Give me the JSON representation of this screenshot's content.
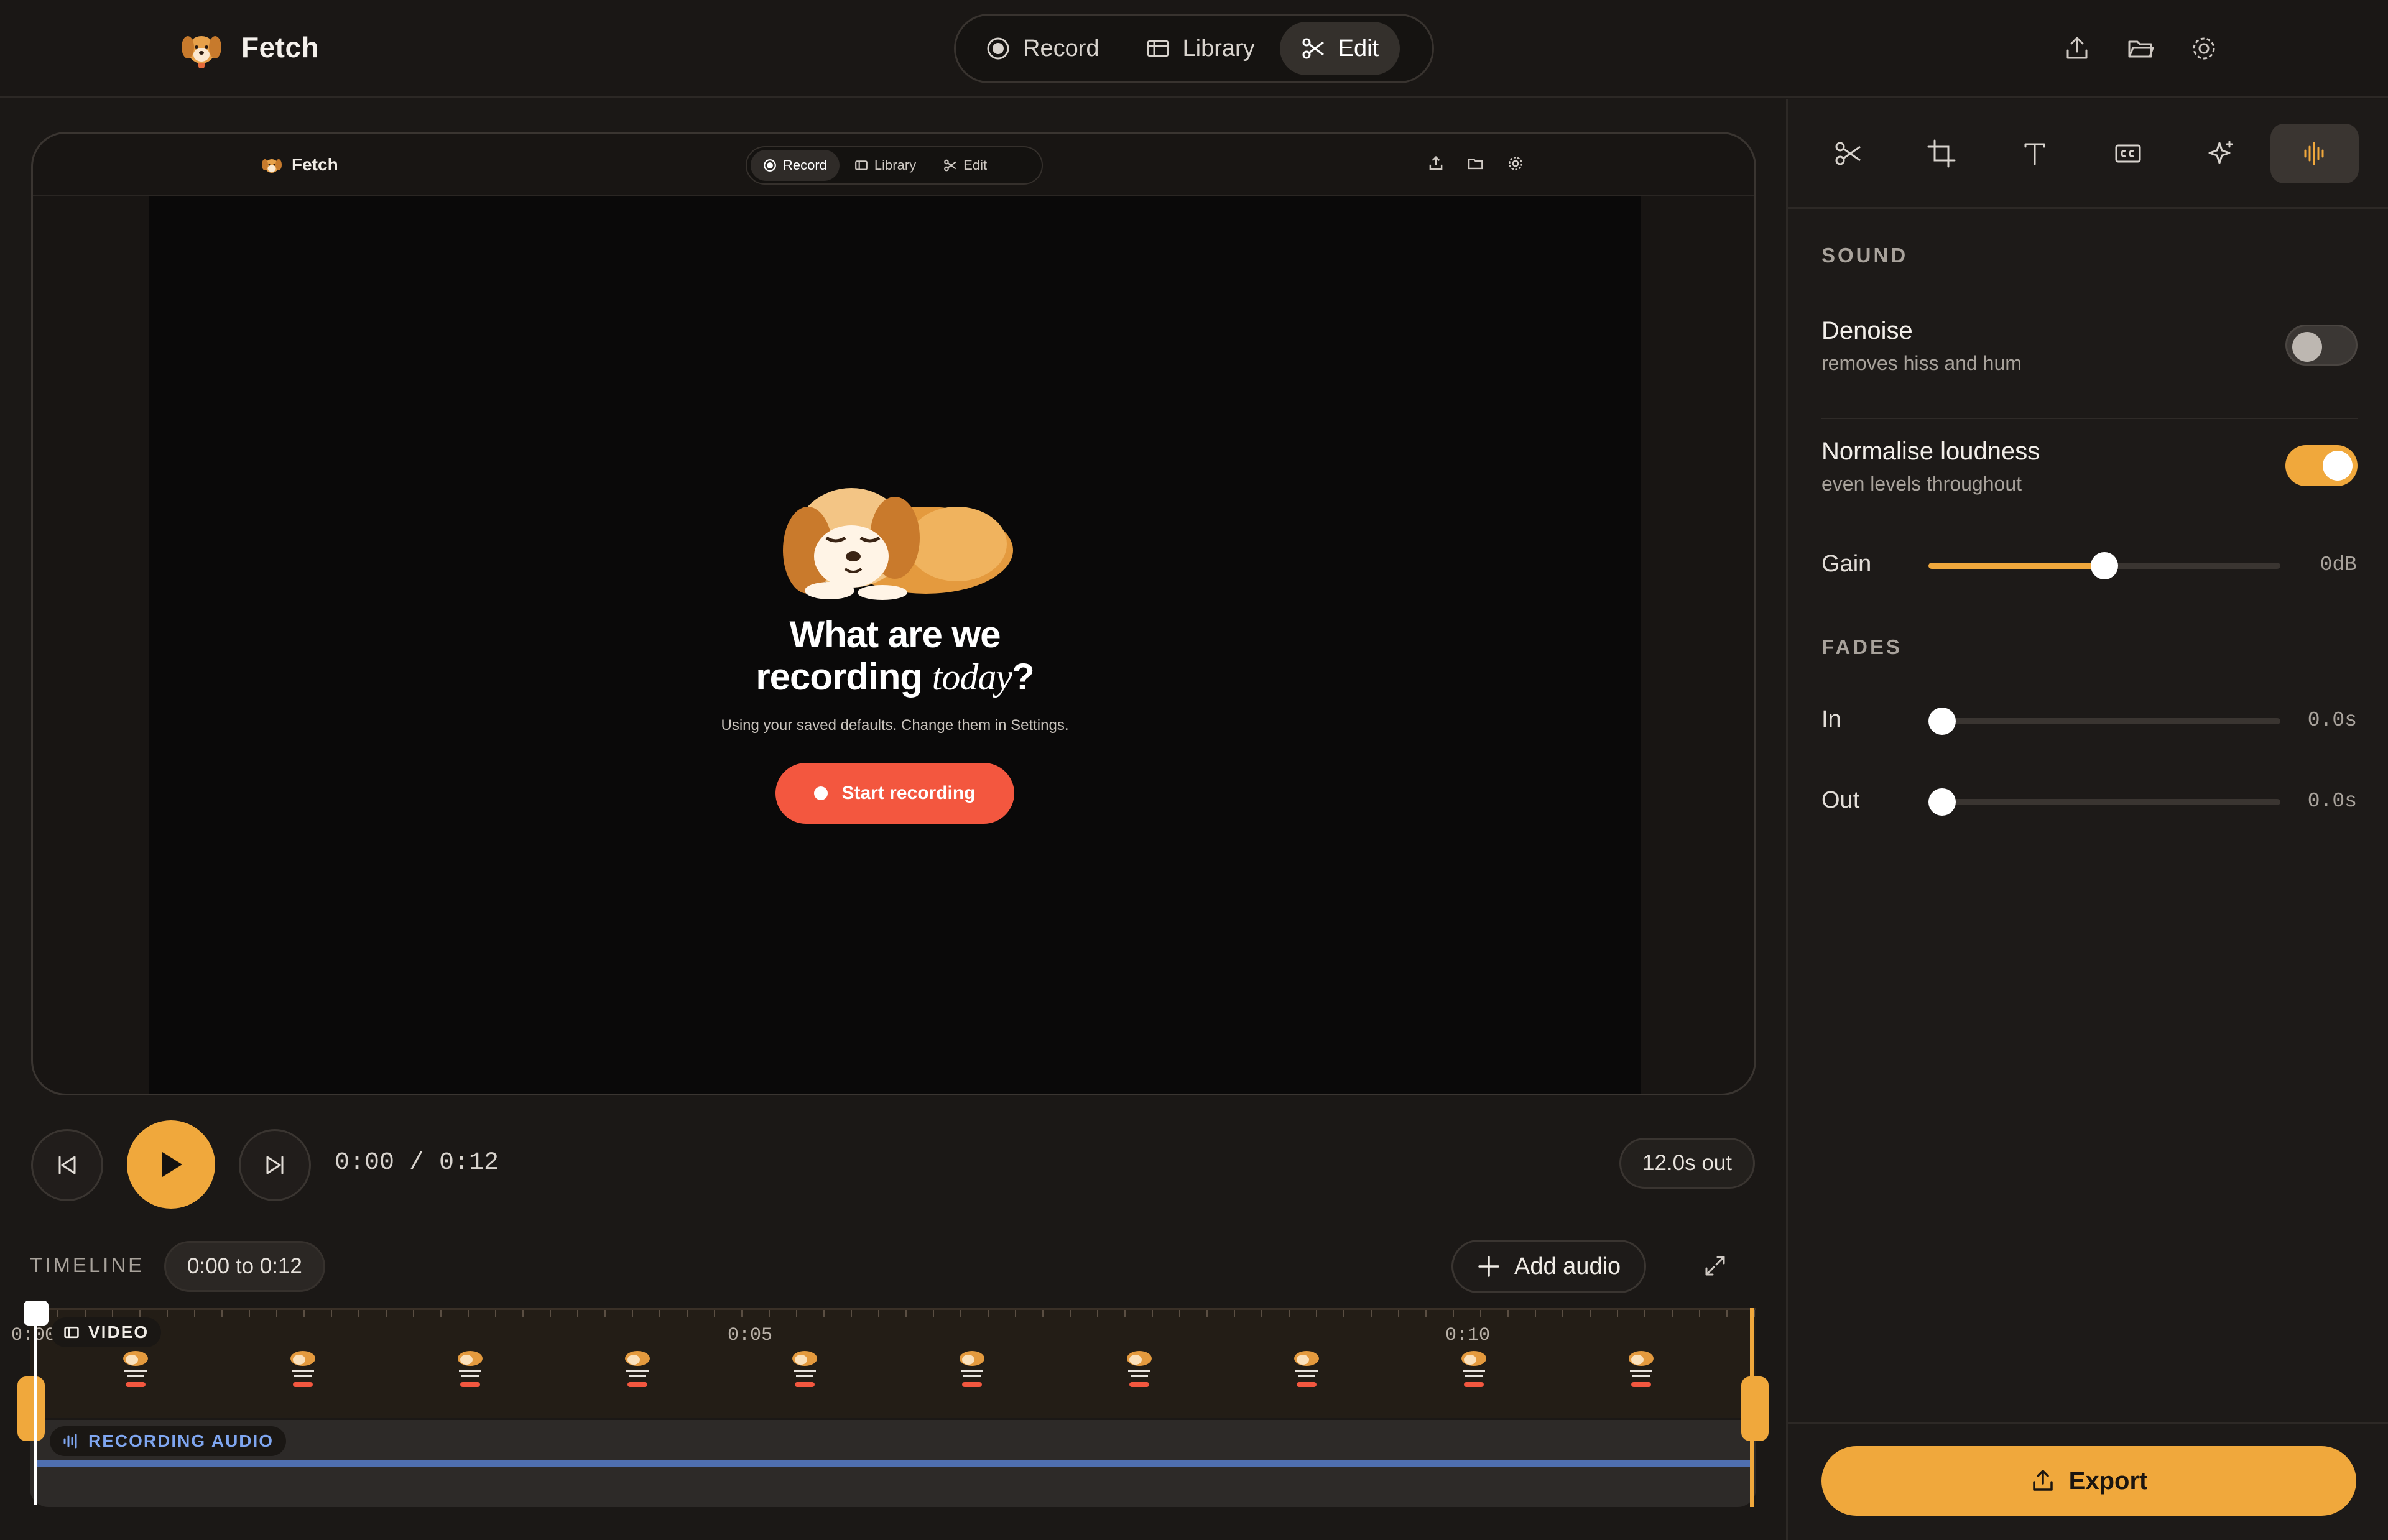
{
  "app": {
    "name": "Fetch"
  },
  "nav": {
    "items": [
      {
        "label": "Record",
        "icon": "record-icon"
      },
      {
        "label": "Library",
        "icon": "library-icon"
      },
      {
        "label": "Edit",
        "icon": "scissors-icon",
        "active": true
      }
    ]
  },
  "top_actions": [
    "upload-icon",
    "folder-icon",
    "gear-icon"
  ],
  "preview": {
    "mini_nav": [
      "Record",
      "Library",
      "Edit"
    ],
    "brand": "Fetch",
    "hero_title_line1": "What are we",
    "hero_title_line2": "recording",
    "hero_title_italic": "today",
    "hero_title_end": "?",
    "hero_sub": "Using your saved defaults. Change them in Settings.",
    "start_button": "Start recording"
  },
  "transport": {
    "timecode": "0:00 / 0:12",
    "out_label": "12.0s out"
  },
  "timeline": {
    "label": "TIMELINE",
    "range": "0:00 to 0:12",
    "add_audio": "Add audio",
    "ticks": [
      "0:00",
      "0:05",
      "0:10"
    ],
    "video_track": "VIDEO",
    "audio_track": "RECORDING AUDIO"
  },
  "panel": {
    "tools": [
      "scissors-icon",
      "crop-icon",
      "text-icon",
      "captions-icon",
      "sparkle-icon",
      "audio-wave-icon"
    ],
    "sound_heading": "SOUND",
    "denoise": {
      "title": "Denoise",
      "sub": "removes hiss and hum",
      "on": false
    },
    "normalise": {
      "title": "Normalise loudness",
      "sub": "even levels throughout",
      "on": true
    },
    "gain": {
      "label": "Gain",
      "value": "0dB",
      "level": 0.5
    },
    "fades_heading": "FADES",
    "fade_in": {
      "label": "In",
      "value": "0.0s",
      "level": 0
    },
    "fade_out": {
      "label": "Out",
      "value": "0.0s",
      "level": 0
    },
    "export": "Export"
  },
  "colors": {
    "accent": "#f0a83c",
    "record": "#f3573f",
    "audio_wave": "#4f6fb0"
  }
}
